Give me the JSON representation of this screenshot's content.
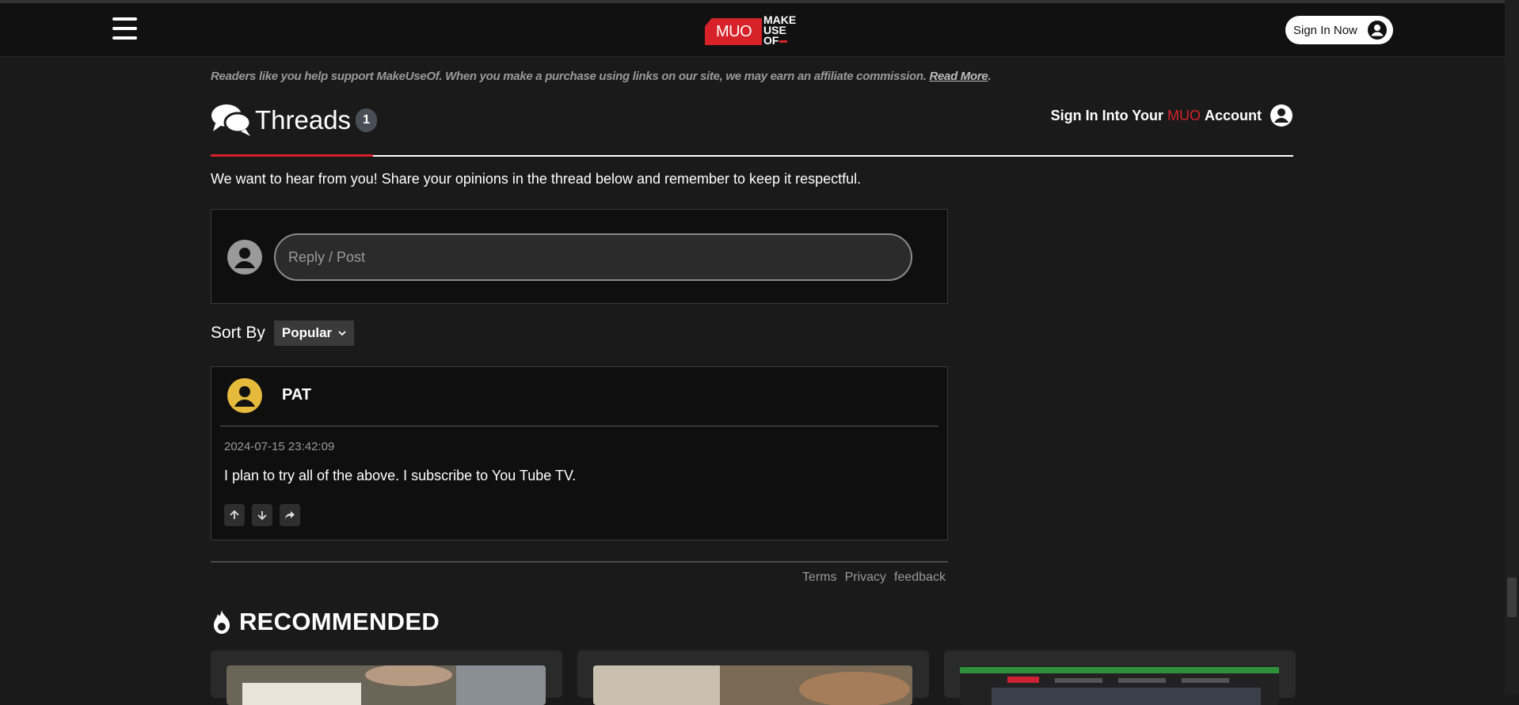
{
  "header": {
    "logo_mark": "MUO",
    "logo_lines": [
      "MAKE",
      "USE",
      "OF"
    ],
    "signin_label": "Sign In Now"
  },
  "affiliate": {
    "text": "Readers like you help support MakeUseOf. When you make a purchase using links on our site, we may earn an affiliate commission.",
    "link": "Read More",
    "suffix": "."
  },
  "threads": {
    "title": "Threads",
    "count": "1",
    "signin_prefix": "Sign In Into Your",
    "signin_brand": "MUO",
    "signin_suffix": "Account",
    "intro": "We want to hear from you! Share your opinions in the thread below and remember to keep it respectful.",
    "reply_placeholder": "Reply / Post",
    "sort_label": "Sort By",
    "sort_value": "Popular"
  },
  "comment": {
    "user": "PAT",
    "timestamp": "2024-07-15 23:42:09",
    "text": "I plan to try all of the above. I subscribe to You Tube TV."
  },
  "footer_links": [
    "Terms",
    "Privacy",
    "feedback"
  ],
  "recommended": {
    "title": "RECOMMENDED"
  },
  "colors": {
    "brand_red": "#d72229",
    "avatar_yellow": "#e4b93c",
    "background": "#1a1a1a"
  }
}
